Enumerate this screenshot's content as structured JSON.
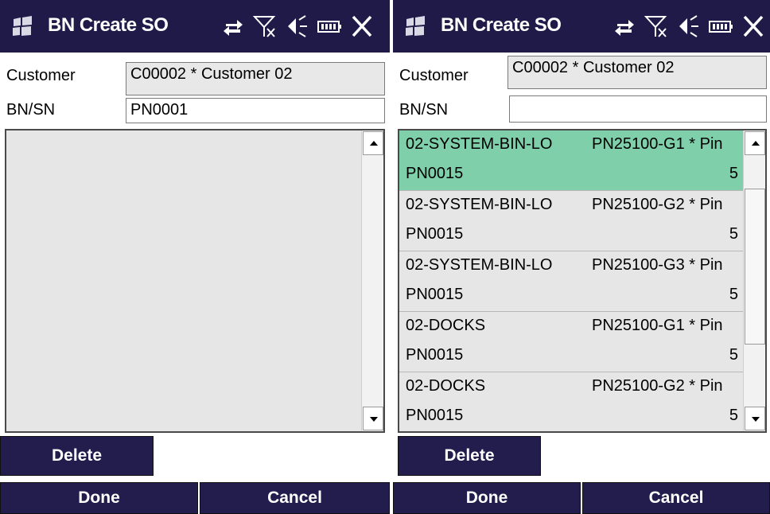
{
  "colors": {
    "titlebar": "#1f1a47",
    "button": "#221d4c",
    "selected_row": "#7ecfaa",
    "readonly_field": "#e8e8e8",
    "list_background": "#e6e6e6"
  },
  "system_icons": [
    "connectivity-icon",
    "no-signal-icon",
    "volume-icon",
    "battery-icon",
    "close-icon"
  ],
  "screens": [
    {
      "title": "BN Create SO",
      "customer": {
        "label": "Customer",
        "value": "C00002 * Customer 02"
      },
      "bnsn": {
        "label": "BN/SN",
        "value": "PN0001"
      },
      "list": {
        "rows": []
      },
      "buttons": {
        "delete": "Delete",
        "done": "Done",
        "cancel": "Cancel"
      }
    },
    {
      "title": "BN Create SO",
      "customer": {
        "label": "Customer",
        "value": "C00002 * Customer 02"
      },
      "bnsn": {
        "label": "BN/SN",
        "value": ""
      },
      "list": {
        "selected_index": 0,
        "scroll_position": 0.35,
        "rows": [
          {
            "bin": "02-SYSTEM-BIN-LO",
            "item": "PN25100-G1 * Pin",
            "pn": "PN0015",
            "qty": "5"
          },
          {
            "bin": "02-SYSTEM-BIN-LO",
            "item": "PN25100-G2 * Pin",
            "pn": "PN0015",
            "qty": "5"
          },
          {
            "bin": "02-SYSTEM-BIN-LO",
            "item": "PN25100-G3 * Pin",
            "pn": "PN0015",
            "qty": "5"
          },
          {
            "bin": "02-DOCKS",
            "item": "PN25100-G1 * Pin",
            "pn": "PN0015",
            "qty": "5"
          },
          {
            "bin": "02-DOCKS",
            "item": "PN25100-G2 * Pin",
            "pn": "PN0015",
            "qty": "5"
          }
        ]
      },
      "buttons": {
        "delete": "Delete",
        "done": "Done",
        "cancel": "Cancel"
      }
    }
  ]
}
